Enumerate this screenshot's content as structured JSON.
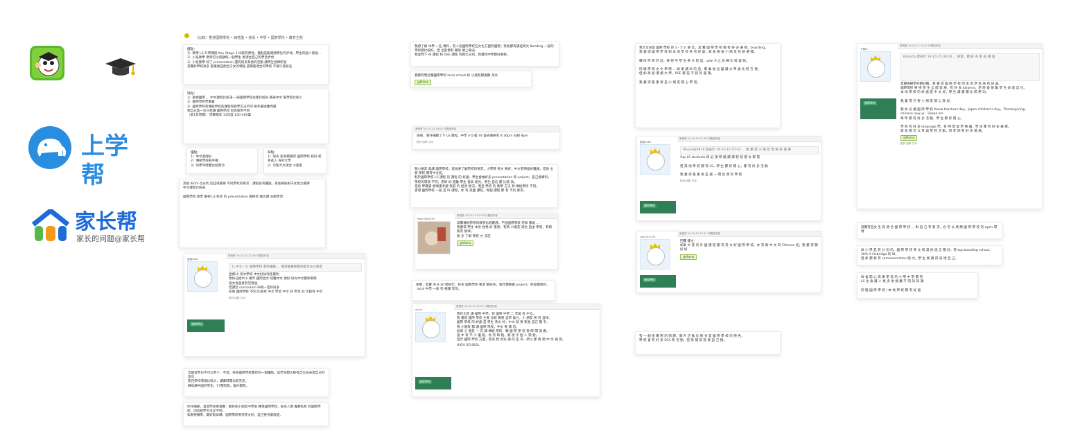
{
  "logos": {
    "shangxuebang": "上学帮",
    "jiazhangbang": "家长帮",
    "jiazhangbang_slogan": "家长的问题@家长帮",
    "colors": {
      "blue": "#2a8ee0",
      "shang_text": "#2a8ee0",
      "jia_blue": "#1e6bd8",
      "jia_orange": "#f39a1c",
      "jia_green": "#57b84a"
    }
  },
  "breadcrumb": "（比較）香港國際學校 • 西營盤 • 家長 • 中學 • 國際學校 • 教育主題",
  "col1": {
    "c1": "優點：\n1）教學 LS 升學課程 Key Stage 3 比較有彈性，優點是能跟隨學生的步伐，學生的個人發展...\n2）小班教學 老師可以照顧每一個學生 更適合自己的學習步伐\n3）小班教學 除了 presentation 還有很多其他的活動 讓學生發揮所長\n其實好學校很多 最重要是配合子女的特點 選擇最適合的學校 不要只看排名",
    "c2": "缺點：\n1）重視國際 ... 中文課程比較淺 一般國際學校生都比較好 將來中文 幫學校比較少\n2）國際學校學費貴\n3）國際學校和傳統學校的課程和教學方法不同 要考慮適應問題\n我自己第一位只想讀 國際學校 因為教學不同\n（第1年學費） 學費每年 15年度 $50-400萬",
    "c3a": "優點：\n1）中文基礎好\n2）傳統學校較平穩\n3）同學平時都比較用功",
    "c3b": "缺點：\n1）很多 家長都覺得 國際學校 較好 較易進入 海外大學\n2）可能不太適合 小朋友",
    "c4": "其他 IB/LS 也分別 這些很重要 不同學校的要求，課程各有優點，家長要按照子女能力選擇\n中文課程比較弱\n\n國際學校 教學 重視 LS 科目 的 presentation 做研究 做功課 主動學習",
    "c5_header": "家長會 19-10-15 12:26 只看該作者",
    "c5_user": "盧嘉Sabe",
    "c5_quote": "1) 中文 / 2) 國際學校 都有優點 ... 覺得最重要都係配合返小朋友",
    "c5": "直資LS 英文學校 中文好似唔係最叻\n我係已經中小 幾年 國際直文 唔難中文 要好 好似中文都係麻麻\n語文係直接有堂增強\n但課堂 curriculum IB唔一定好好多\n如果 國際學校 不同 比較有 中文 學習 中文 好 學生 好 比較有 中文",
    "c5_actions": "點評   回覆   引用",
    "c6": "出國留學也不可以參少：不過，好多國際學校都有同一個優點，是學生都比較有自信去表達自己的意見，\n而且學校環境比較大，讀書時間比較充足，\n轉IB讀中國的學生，Y7都有教。國內都有。",
    "c7": "你仔細睇，直資學校要落實：最好係小朋友中學後 轉落國際學校，好多人都 推薦私校 和國際學校，因為教學方法又不同，\n如果要轉學，最好就早轉，國際學校要求英文好，自己要考慮清楚。"
  },
  "col2": {
    "c1": "我想了解 中學 一些 資料，有人說國際學校在文化方面有優勢；家長都有講過英文 Banding 一般的學校都比較好，但 全部資料 都係 網上睇返，\n我會問下 IB 課程 和 DSE 課程 有幾大分別，我覺得中學都好重要。",
    "c2": "我都有問這種國際學校 local school 好 小朋友都喜歡 英文",
    "c2_badge": "@Mama",
    "c3_header": "家長會 19-10-15 16:04 只看該作者",
    "c3": "係呢，我仔細睇了下 LS 課程，中學 4-5 級 Y8 會去做研究 9.30pm 已經 9pm",
    "c3_actions": "點評   回覆   引用",
    "c4": "我小朋友 就讀 國際學校，家長要了解學校的要求，小學時 英文 要好，中文有時會好難跟，但係 主要 學校 都有中文班。\n對於國際學校 LS 課程 的 課程 的 好處，學生會做好多 presentation 和 project，自己搵資料，\n學校的環境 不同，老師 好 鼓勵 學生 發表 意見，學生 自信 都 比較 高。\n但係 學費貴 要慎重考慮 家庭 的 經濟 狀況，而且 學校 的 教學 方法 和 傳統學校 不同。\n香港 國際學校 一般 是 IB 課程，亦 有 英國 課程，每個 課程 都 有 不同 要求。",
    "c5_header": "家長會 19-10-15 07:42 只看該作者",
    "c5_user": "Moonlight878",
    "c5": "其實傳統學校的教學比較嚴謹，不過國際學校 老師 都會 ...\n我覺得 學生 本身 性格 好 重要，有啲 小朋友 適合 自由 學習，有啲 要有 規律。\n要 多 了解 學校 才 決定",
    "c5_badge": "@Mama",
    "c6": "係喔，其實 IB 8:30 都好忙，好多 國際學校 要求 都好多，每年都要做 project，校長都唔同，\n local 中學 一般 有 補課 等等。",
    "c7_header": "家長會 19-10-15 12:01 只看該作者",
    "c7_user": "vicuti",
    "c7": "我在大陸 讀 國際 中學，有 國際 中學 二 年級 有 中文。\n我 覺得 國際 學校 主要 比較 著重 自學 能力，小 朋友 要 有 自律。\n國際 學校 的 好處 是 學生 英文 好，中文 就 要 家長 自己 幫 手。\n我 小朋友 都 讀 國際 學校，中文 要 補 習。\n如果 小 朋友 一 向 讀 傳統 學校，轉 國 際 學 校 要 時 間 適 應。\n當 中 有 不 少 優 點，亦 有 缺 點，要 視 乎 個 人 需 要。\n至於 國際 學校 方面，因為 我 女兒 讀 的 是 IB，所以 都 要 搵 中 文 補 習。",
    "c7_footer": "HIGH SCHOOL"
  },
  "col3": {
    "c1": "我大女兒是 國際 學校 的 3 - 5 小 朋 友，其 實 國 際 學 校 都 有 好 多 選 擇，boarding，\n我 覺 得 國 際 學 校 和 本 地 學 校 各 有 好 處，家 長 要 按 小 朋 友 性 格 選 擇。\n\n轉 IB 學 校 的 話，要 視 乎 學 生 英 文 程 度，year 9 之 前 轉 比 較 容 易。\n\n同 樣 學 英 文 中 學 時 ... 如 果 讀 IB 的 話，畢 業 後 出 國 讀 大 學 會 比 較 方 便。\n但 如 果 留 港 讀 大 學，DSE 都 是 不 錯 的 選 擇。\n\n我 覺 得 最 重 要 是 小 朋 友 開 心 學 習。",
    "c2_header": "家長會 19-10-15 11:36 只看該作者",
    "c2_user": "盧嘉Sabe",
    "c2_quote": "Moonlight878 發表於 19-10-15 07:42 ... 我 覺 得 小 朋 友 性 格 好 重 要",
    "c2": "Yup LS students 係 必 須 明 確 讀 課 程 唔 使 太 緊 張\n\n但 其 他 學 校 都 有 LS，學 生 都 好 開 心，都 有 好 多 活 動\n\n我 覺 得 最 重 要 是 選 一 間 合 適 的 學 校",
    "c2_actions": "點評   回覆   引用",
    "c3_header": "家長會 19-10-15 12:41 只看該作者",
    "c3_user": "Lok0311078",
    "c3": "回覆 樓主：\n如果 大 陸 的 外 國 課 程 都 有 英 文 好 國 際 學 校，亦 有 教 中 文 同 Chinese 班，我 覺 得 都 好 好",
    "c3_badge": "@Mama",
    "c4": "有 一 個 很 實 際 的 問 題，課 外 活 動 比 較 多 是 國 際 學 校 的 特 色，\n學 校 會 有 好 多 ECA 和 活 動，但 係 補 習 就 要 自 己 搵。"
  },
  "col4": {
    "c1_header": "家長會 19-10-15 10:37 只看該作者",
    "c1_user": "子喜年",
    "c1_quote": "Roberta 發表於 19-10-15 08:20 ... 同意，都 好 多 家 長 講 過",
    "c1": "其實要揀學校都好難，我 覺 得 國 際 學 校 同 本 地 學 校 各 有 好 處。\n國際學校 重 視 學 生 全 面 發 展，有 好 多 balance，老 師 會 鼓 勵 學 生 表 達 自 己。\n本 地 學 校 的 好 處 是 中 文 好，學 生 讀 書 都 比 較 用 功。\n\n我 覺 得 只 要 小 朋 友 開 心 就 好。\n\n我 女 兒 讀 國 際 學 校 Korea teachers day，Japan children's day，Thanksgiving，chinese new yr，Diwali etc\n每 年 都 有 好 多 活 動，學 生 都 好 開 心。\n\n學 校 有 好 多 language 學，有 時 間 會 學 樂 器，學 生 都 有 好 多 選 擇。\n家 長 都 可 以 參 與 學 校 活 動，同 老 師 有 好 多 溝 通。",
    "c1_badge": "@Mama",
    "c1_actions": "點評   回覆   引用",
    "c2": "其實有些女 生 就 適 合 國 際 學 校 ... 對 自 己 有 要 求，亦 可 以 適 應 國 際 學 校 的 open 環 境",
    "c3": "IB 小 學 是 有 分 別 的，國 際 學 校 英 文 和 其 他 語 言 都 好，有 top boarding school，\n30% A Oxbridge 的 IB，\n但 係 都 要 有 communication 能 力，學 生 要 識 得 表 達 自 己。",
    "c4": "IB 會 開 心 快 樂 學 習 的 小 學 中 學 都 有\nLS 也 會 讓 人 更 多 地 接 觸 不 同 的 知 識\n\n同 理 國 際 學 校 / 本 地 學 校 都 有 好 處"
  },
  "colors": {
    "badge_bg": "#e8f5d0",
    "badge_border": "#8dbf3c",
    "banner": "#2f7e55"
  }
}
